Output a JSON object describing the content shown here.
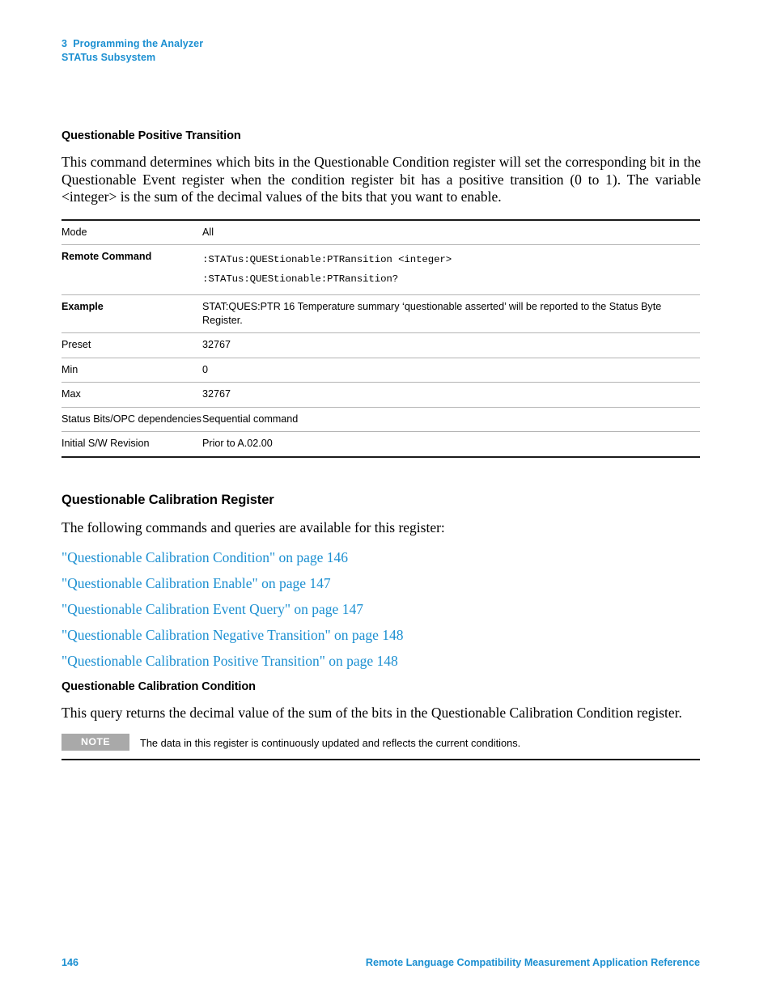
{
  "header": {
    "chapter_line": "3  Programming the Analyzer",
    "subsystem_line": "STATus Subsystem"
  },
  "section1": {
    "title": "Questionable Positive Transition",
    "paragraph": "This command determines which bits in the Questionable Condition register will set the corresponding bit in the Questionable Event register when the condition register bit has a positive transition (0 to 1). The variable <integer> is the sum of the decimal values of the bits that you want to enable.",
    "table": {
      "rows": [
        {
          "key": "Mode",
          "value": "All"
        },
        {
          "key": "Remote Command",
          "value_line1": ":STATus:QUEStionable:PTRansition <integer>",
          "value_line2": ":STATus:QUEStionable:PTRansition?"
        },
        {
          "key": "Example",
          "value": "STAT:QUES:PTR 16 Temperature summary ‘questionable asserted’ will be reported to the Status Byte Register."
        },
        {
          "key": "Preset",
          "value": "32767"
        },
        {
          "key": "Min",
          "value": "0"
        },
        {
          "key": "Max",
          "value": "32767"
        },
        {
          "key": "Status Bits/OPC dependencies",
          "value": "Sequential command"
        },
        {
          "key": "Initial S/W Revision",
          "value": "Prior to A.02.00"
        }
      ]
    }
  },
  "section2": {
    "title": "Questionable Calibration Register",
    "intro": "The following commands and queries are available for this register:",
    "links": [
      "\"Questionable Calibration Condition\" on page 146",
      "\"Questionable Calibration Enable\" on page 147",
      "\"Questionable Calibration Event Query\" on page 147",
      "\"Questionable Calibration Negative Transition\" on page 148",
      "\"Questionable Calibration Positive Transition\" on page 148"
    ]
  },
  "section3": {
    "title": "Questionable Calibration Condition",
    "paragraph": "This query returns the decimal value of the sum of the bits in the Questionable Calibration Condition register.",
    "note": {
      "badge": "NOTE",
      "text": "The data in this register is continuously updated and reflects the current conditions."
    }
  },
  "footer": {
    "page_number": "146",
    "document_title": "Remote Language Compatibility Measurement Application Reference"
  },
  "colors": {
    "accent_blue": "#1b8fd1",
    "note_badge_gray": "#a9a9a9",
    "rule_dark": "#1a1a1a",
    "rule_light": "#b4b4b4"
  }
}
